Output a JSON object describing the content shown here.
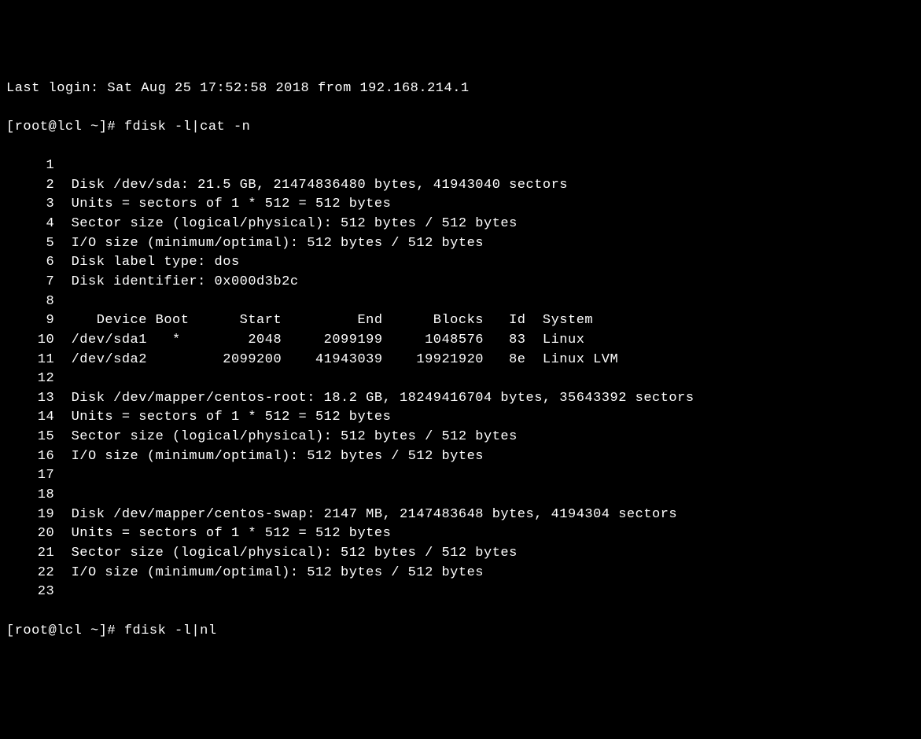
{
  "last_login": "Last login: Sat Aug 25 17:52:58 2018 from 192.168.214.1",
  "prompt1": "[root@lcl ~]# fdisk -l|cat -n",
  "lines": [
    {
      "num": "1",
      "content": ""
    },
    {
      "num": "2",
      "content": "Disk /dev/sda: 21.5 GB, 21474836480 bytes, 41943040 sectors"
    },
    {
      "num": "3",
      "content": "Units = sectors of 1 * 512 = 512 bytes"
    },
    {
      "num": "4",
      "content": "Sector size (logical/physical): 512 bytes / 512 bytes"
    },
    {
      "num": "5",
      "content": "I/O size (minimum/optimal): 512 bytes / 512 bytes"
    },
    {
      "num": "6",
      "content": "Disk label type: dos"
    },
    {
      "num": "7",
      "content": "Disk identifier: 0x000d3b2c"
    },
    {
      "num": "8",
      "content": ""
    },
    {
      "num": "9",
      "content": "   Device Boot      Start         End      Blocks   Id  System"
    },
    {
      "num": "10",
      "content": "/dev/sda1   *        2048     2099199     1048576   83  Linux"
    },
    {
      "num": "11",
      "content": "/dev/sda2         2099200    41943039    19921920   8e  Linux LVM"
    },
    {
      "num": "12",
      "content": ""
    },
    {
      "num": "13",
      "content": "Disk /dev/mapper/centos-root: 18.2 GB, 18249416704 bytes, 35643392 sectors"
    },
    {
      "num": "14",
      "content": "Units = sectors of 1 * 512 = 512 bytes"
    },
    {
      "num": "15",
      "content": "Sector size (logical/physical): 512 bytes / 512 bytes"
    },
    {
      "num": "16",
      "content": "I/O size (minimum/optimal): 512 bytes / 512 bytes"
    },
    {
      "num": "17",
      "content": ""
    },
    {
      "num": "18",
      "content": ""
    },
    {
      "num": "19",
      "content": "Disk /dev/mapper/centos-swap: 2147 MB, 2147483648 bytes, 4194304 sectors"
    },
    {
      "num": "20",
      "content": "Units = sectors of 1 * 512 = 512 bytes"
    },
    {
      "num": "21",
      "content": "Sector size (logical/physical): 512 bytes / 512 bytes"
    },
    {
      "num": "22",
      "content": "I/O size (minimum/optimal): 512 bytes / 512 bytes"
    },
    {
      "num": "23",
      "content": ""
    }
  ],
  "prompt2": "[root@lcl ~]# fdisk -l|nl"
}
